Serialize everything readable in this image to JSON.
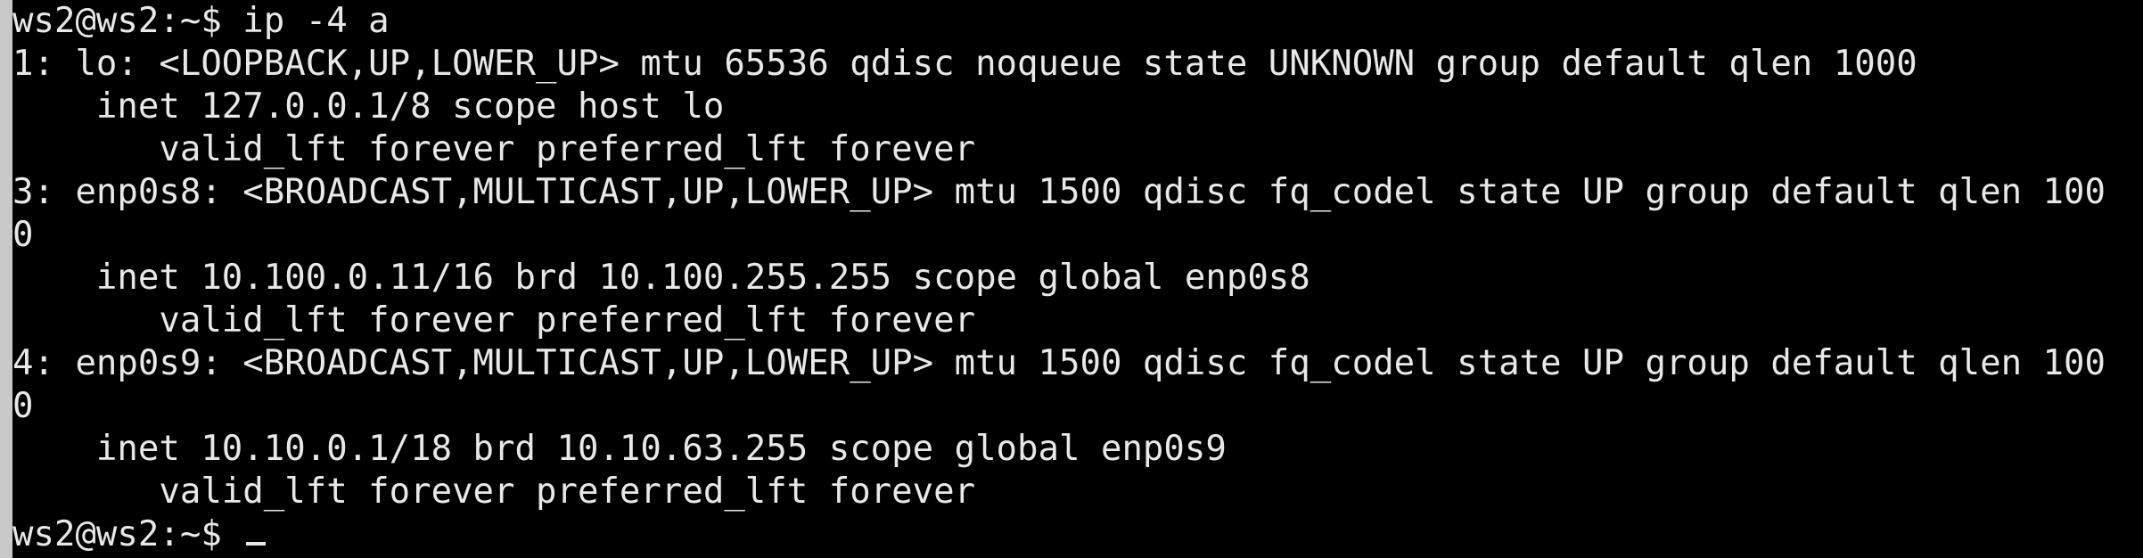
{
  "terminal": {
    "lines": [
      "ws2@ws2:~$ ip -4 a",
      "1: lo: <LOOPBACK,UP,LOWER_UP> mtu 65536 qdisc noqueue state UNKNOWN group default qlen 1000",
      "    inet 127.0.0.1/8 scope host lo",
      "       valid_lft forever preferred_lft forever",
      "3: enp0s8: <BROADCAST,MULTICAST,UP,LOWER_UP> mtu 1500 qdisc fq_codel state UP group default qlen 100",
      "0",
      "    inet 10.100.0.11/16 brd 10.100.255.255 scope global enp0s8",
      "       valid_lft forever preferred_lft forever",
      "4: enp0s9: <BROADCAST,MULTICAST,UP,LOWER_UP> mtu 1500 qdisc fq_codel state UP group default qlen 100",
      "0",
      "    inet 10.10.0.1/18 brd 10.10.63.255 scope global enp0s9",
      "       valid_lft forever preferred_lft forever"
    ],
    "prompt": "ws2@ws2:~$ "
  },
  "colors": {
    "background": "#000000",
    "text": "#e8e8e8"
  }
}
